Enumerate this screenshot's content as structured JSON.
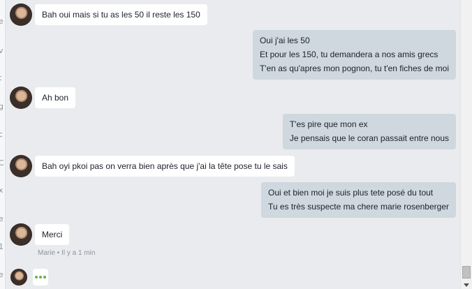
{
  "conversation": {
    "messages": [
      {
        "direction": "in",
        "lines": [
          "Bah oui mais si tu as les 50 il reste les 150"
        ]
      },
      {
        "direction": "out",
        "lines": [
          "Oui j'ai les 50",
          "Et pour les 150, tu demandera a nos amis grecs",
          "T'en as qu'apres mon pognon, tu t'en fiches de moi"
        ]
      },
      {
        "direction": "in",
        "lines": [
          "Ah bon"
        ]
      },
      {
        "direction": "out",
        "lines": [
          "T'es pire que mon ex",
          "Je pensais que le coran passait entre nous"
        ]
      },
      {
        "direction": "in",
        "lines": [
          "Bah oyi pkoi pas on verra bien après que j'ai la tête pose tu le sais"
        ]
      },
      {
        "direction": "out",
        "lines": [
          "Oui et bien moi je suis plus tete posé du tout",
          "Tu es très suspecte ma chere marie rosenberger"
        ]
      },
      {
        "direction": "in",
        "lines": [
          "Merci"
        ]
      }
    ],
    "last_seen": "Marie • Il y a 1 min",
    "typing_indicator": "typing-dots-icon"
  },
  "sidebar_letters": [
    "e",
    "v",
    "t",
    "g",
    "c",
    "C",
    "x",
    "e",
    "1",
    "e"
  ],
  "colors": {
    "background": "#e9ebee",
    "incoming_bubble": "#ffffff",
    "outgoing_bubble": "#cfd7df",
    "typing_dots": "#6bb04b",
    "meta_text": "#90949c"
  }
}
